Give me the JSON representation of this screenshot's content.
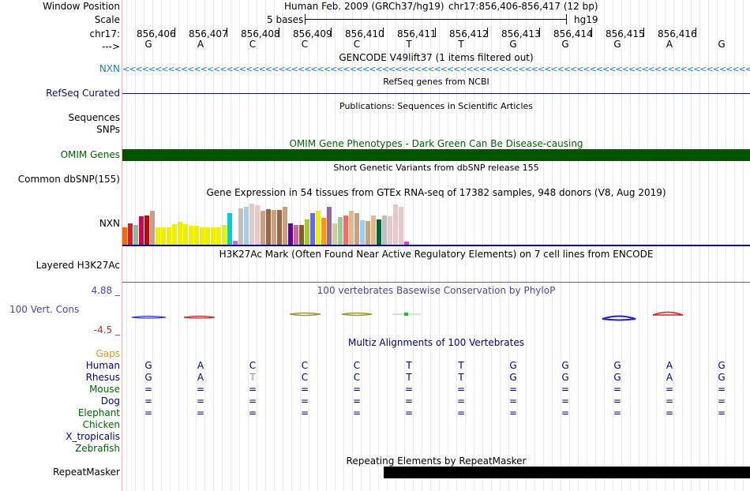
{
  "header": {
    "window_position_label": "Window Position",
    "scale_label": "Scale",
    "chrom_label": "chr17:",
    "strand_label": "--->",
    "assembly_text": "Human Feb. 2009 (GRCh37/hg19)",
    "position_text": "chr17:856,406-856,417 (12 bp)",
    "scale_text": "5 bases",
    "scale_db": "hg19"
  },
  "ruler": {
    "ticks": [
      "856,406",
      "856,407",
      "856,408",
      "856,409",
      "856,410",
      "856,411",
      "856,412",
      "856,413",
      "856,414",
      "856,415",
      "856,416"
    ],
    "bases": [
      "G",
      "A",
      "C",
      "C",
      "C",
      "T",
      "T",
      "G",
      "G",
      "G",
      "A",
      "G"
    ]
  },
  "tracks": {
    "gencode": {
      "title": "GENCODE V49lift37 (1 items filtered out)",
      "label": "NXN"
    },
    "refseq": {
      "title": "RefSeq genes from NCBI",
      "label": "RefSeq Curated"
    },
    "pubs": {
      "title": "Publications: Sequences in Scientific Articles",
      "label_line1": "Sequences",
      "label_line2": "SNPs"
    },
    "omim": {
      "title": "OMIM Gene Phenotypes - Dark Green Can Be Disease-causing",
      "label": "OMIM Genes"
    },
    "dbsnp": {
      "title": "Short Genetic Variants from dbSNP release 155",
      "label": "Common dbSNP(155)"
    },
    "gtex": {
      "title": "Gene Expression in 54 tissues from GTEx RNA-seq of 17382 samples, 948 donors (V8, Aug 2019)",
      "label": "NXN",
      "levels": [
        0.42,
        0.52,
        0.48,
        0.7,
        0.72,
        0.82,
        0.42,
        0.42,
        0.42,
        0.5,
        0.56,
        0.5,
        0.46,
        0.46,
        0.42,
        0.42,
        0.42,
        0.42,
        0.48,
        0.76,
        0.1,
        0.88,
        0.92,
        1.0,
        0.96,
        0.82,
        0.87,
        0.84,
        0.84,
        0.92,
        0.52,
        0.48,
        0.48,
        0.62,
        0.77,
        0.82,
        0.66,
        0.92,
        0.52,
        0.67,
        0.72,
        0.82,
        0.76,
        0.6,
        0.58,
        0.72,
        0.62,
        0.72,
        0.7,
        0.98,
        0.92,
        0.08
      ],
      "colors": [
        "#FF6600",
        "#CC2233",
        "#8FBC8F",
        "#CC0055",
        "#CC0000",
        "#C8A080",
        "#EEEE00",
        "#EEEE00",
        "#EEEE00",
        "#EEEE00",
        "#EEEE00",
        "#EEEE00",
        "#EEEE00",
        "#EEEE00",
        "#EEEE00",
        "#EEEE00",
        "#EEEE00",
        "#EEEE00",
        "#EEEE00",
        "#00CED1",
        "#CC66FF",
        "#BFBFBF",
        "#A6CEE3",
        "#E6C8C8",
        "#E6C8C8",
        "#C8A080",
        "#996644",
        "#C8A080",
        "#996644",
        "#C8A080",
        "#660099",
        "#CC6699",
        "#8B5A2B",
        "#9ACD32",
        "#6666FF",
        "#EEEE00",
        "#FF9900",
        "#996699",
        "#CCCC99",
        "#99CC99",
        "#FF6666",
        "#DDBB88",
        "#C8A080",
        "#99CCFF",
        "#C8A080",
        "#DDBB88",
        "#006633",
        "#BFBFBF",
        "#E6C8C8",
        "#E6C8C8",
        "#E6C8C8",
        "#FF33CC"
      ]
    },
    "h3k27ac": {
      "title": "H3K27Ac Mark (Often Found Near Active Regulatory Elements) on 7 cell lines from ENCODE",
      "label": "Layered H3K27Ac"
    },
    "phylop": {
      "title": "100 vertebrates Basewise Conservation by PhyloP",
      "label": "100 Vert. Cons",
      "max": "4.88 _",
      "min": "-4.5 _"
    },
    "multiz": {
      "title": "Multiz Alignments of 100 Vertebrates",
      "gaps_label": "Gaps",
      "species": [
        {
          "name": "Human",
          "color": "#000080",
          "bases": [
            "G",
            "A",
            "C",
            "C",
            "C",
            "T",
            "T",
            "G",
            "G",
            "G",
            "A",
            "G"
          ]
        },
        {
          "name": "Rhesus",
          "color": "#000080",
          "bases": [
            "G",
            "A",
            "T",
            "C",
            "C",
            "T",
            "T",
            "G",
            "G",
            "G",
            "A",
            "G"
          ]
        },
        {
          "name": "Mouse",
          "color": "#006400",
          "bases": [
            "=",
            "=",
            "=",
            "=",
            "=",
            "=",
            "=",
            "=",
            "=",
            "=",
            "=",
            "="
          ]
        },
        {
          "name": "Dog",
          "color": "#000080",
          "bases": [
            "=",
            "=",
            "=",
            "=",
            "=",
            "=",
            "=",
            "=",
            "=",
            "=",
            "=",
            "="
          ]
        },
        {
          "name": "Elephant",
          "color": "#006400",
          "bases": [
            "=",
            "=",
            "=",
            "=",
            "=",
            "=",
            "=",
            "=",
            "=",
            "=",
            "=",
            "="
          ]
        },
        {
          "name": "Chicken",
          "color": "#006400",
          "bases": []
        },
        {
          "name": "X_tropicalis",
          "color": "#000080",
          "bases": []
        },
        {
          "name": "Zebrafish",
          "color": "#006400",
          "bases": []
        }
      ]
    },
    "repeatmasker": {
      "title": "Repeating Elements by RepeatMasker",
      "label": "RepeatMasker"
    }
  },
  "colors": {
    "nxn_blue": "#1E7FB5",
    "refseq_navy": "#0C0C78",
    "omim_green": "#006400",
    "phylop_label": "#4747A0",
    "gaps_orange": "#E09A10",
    "label_navy": "#000080"
  }
}
